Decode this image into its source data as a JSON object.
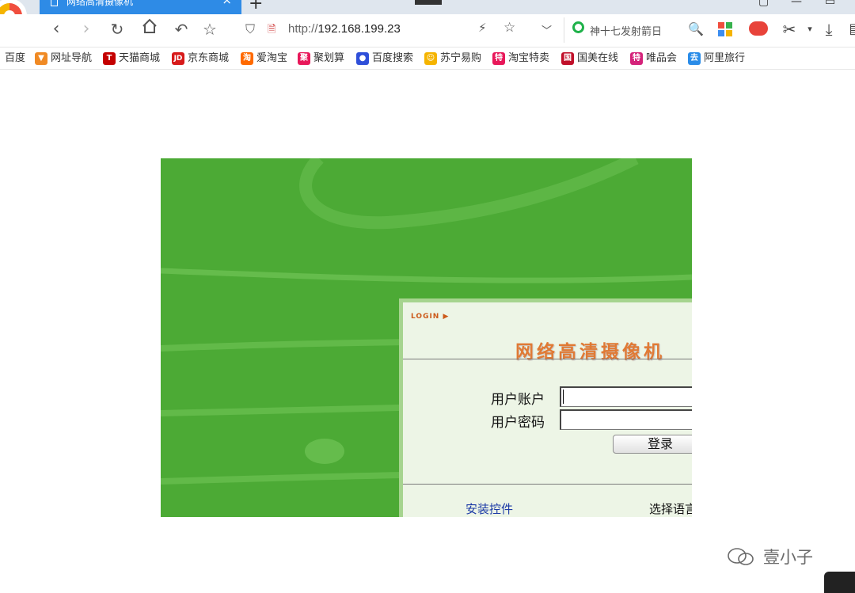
{
  "browser": {
    "tab_title": "网络高清摄像机",
    "address_protocol": "http://",
    "address_host": "192.168.199.23",
    "search_text": "神十七发射箭日",
    "colors": {
      "tab_active": "#2e8be6",
      "panel_green": "#4caa35"
    }
  },
  "bookmarks": [
    {
      "label": "百度",
      "icon": "none"
    },
    {
      "label": "网址导航",
      "icon": "chevron-badge-icon",
      "color": "#f08a24"
    },
    {
      "label": "天猫商城",
      "icon": "tmall-icon",
      "glyph": "T",
      "color": "#c40000"
    },
    {
      "label": "京东商城",
      "icon": "jd-icon",
      "glyph": "JD",
      "color": "#d71a1a"
    },
    {
      "label": "爱淘宝",
      "icon": "taobao-icon",
      "glyph": "淘",
      "color": "#ff6a00"
    },
    {
      "label": "聚划算",
      "icon": "juhuasuan-icon",
      "glyph": "聚",
      "color": "#e8185a"
    },
    {
      "label": "百度搜索",
      "icon": "baidu-paw-icon",
      "glyph": "🐾",
      "color": "#2f4fd9"
    },
    {
      "label": "苏宁易购",
      "icon": "suning-icon",
      "glyph": "☺",
      "color": "#f5b400"
    },
    {
      "label": "淘宝特卖",
      "icon": "tmai-icon",
      "glyph": "特",
      "color": "#e8185a"
    },
    {
      "label": "国美在线",
      "icon": "gome-icon",
      "glyph": "国",
      "color": "#c0102a"
    },
    {
      "label": "唯品会",
      "icon": "vip-icon",
      "glyph": "特",
      "color": "#d4237a"
    },
    {
      "label": "阿里旅行",
      "icon": "alitrip-icon",
      "glyph": "去",
      "color": "#2a8ce8"
    }
  ],
  "login": {
    "badge": "LOGIN ▶",
    "title": "网络高清摄像机",
    "username_label": "用户账户",
    "password_label": "用户密码",
    "submit": "登录",
    "install_link": "安装控件",
    "language_label": "选择语言"
  },
  "watermark": {
    "text": "壹小子"
  }
}
